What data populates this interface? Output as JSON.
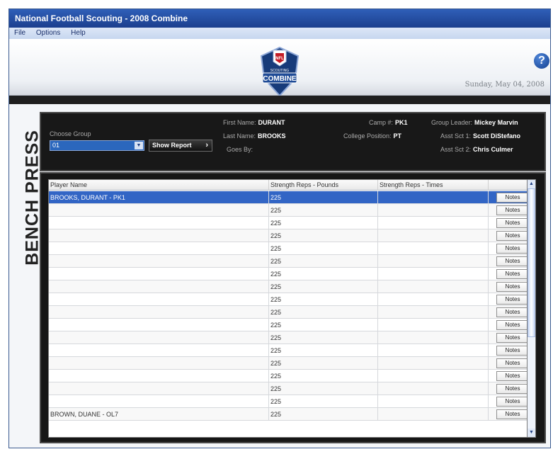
{
  "window": {
    "title": "National Football Scouting - 2008 Combine"
  },
  "menu": {
    "items": [
      "File",
      "Options",
      "Help"
    ]
  },
  "header": {
    "date": "Sunday, May 04, 2008"
  },
  "logo": {
    "brand": "NFL",
    "small": "SCOUTING",
    "big": "COMBINE"
  },
  "page": {
    "title": "BENCH PRESS"
  },
  "group": {
    "label": "Choose Group",
    "selected": "01",
    "show_report_label": "Show Report",
    "show_report_icon": "chevron-right-icon"
  },
  "player": {
    "first_name_label": "First Name:",
    "first_name": "DURANT",
    "last_name_label": "Last Name:",
    "last_name": "BROOKS",
    "goes_by_label": "Goes By:",
    "goes_by": "",
    "camp_label": "Camp #:",
    "camp": "PK1",
    "college_position_label": "College Position:",
    "college_position": "PT"
  },
  "staff": {
    "group_leader_label": "Group Leader:",
    "group_leader": "Mickey Marvin",
    "asst1_label": "Asst Sct 1:",
    "asst1": "Scott DiStefano",
    "asst2_label": "Asst Sct 2:",
    "asst2": "Chris Culmer"
  },
  "table": {
    "columns": [
      "Player Name",
      "Strength Reps - Pounds",
      "Strength Reps - Times",
      ""
    ],
    "notes_label": "Notes",
    "rows": [
      {
        "name": "BROOKS, DURANT - PK1",
        "pounds": "225",
        "times": "",
        "selected": true
      },
      {
        "name": "",
        "pounds": "225",
        "times": ""
      },
      {
        "name": "",
        "pounds": "225",
        "times": ""
      },
      {
        "name": "",
        "pounds": "225",
        "times": ""
      },
      {
        "name": "",
        "pounds": "225",
        "times": ""
      },
      {
        "name": "",
        "pounds": "225",
        "times": ""
      },
      {
        "name": "",
        "pounds": "225",
        "times": ""
      },
      {
        "name": "",
        "pounds": "225",
        "times": ""
      },
      {
        "name": "",
        "pounds": "225",
        "times": ""
      },
      {
        "name": "",
        "pounds": "225",
        "times": ""
      },
      {
        "name": "",
        "pounds": "225",
        "times": ""
      },
      {
        "name": "",
        "pounds": "225",
        "times": ""
      },
      {
        "name": "",
        "pounds": "225",
        "times": ""
      },
      {
        "name": "",
        "pounds": "225",
        "times": ""
      },
      {
        "name": "",
        "pounds": "225",
        "times": ""
      },
      {
        "name": "",
        "pounds": "225",
        "times": ""
      },
      {
        "name": "",
        "pounds": "225",
        "times": ""
      },
      {
        "name": "BROWN, DUANE - OL7",
        "pounds": "225",
        "times": ""
      }
    ]
  },
  "icons": {
    "help": "help-icon",
    "dropdown": "chevron-down-icon",
    "scroll_up": "chevron-up-icon",
    "scroll_down": "chevron-down-icon"
  },
  "colors": {
    "title_bar": "#1c3f8e",
    "selection": "#3265c5",
    "dark_panel": "#181818",
    "accent": "#2b67bd"
  }
}
